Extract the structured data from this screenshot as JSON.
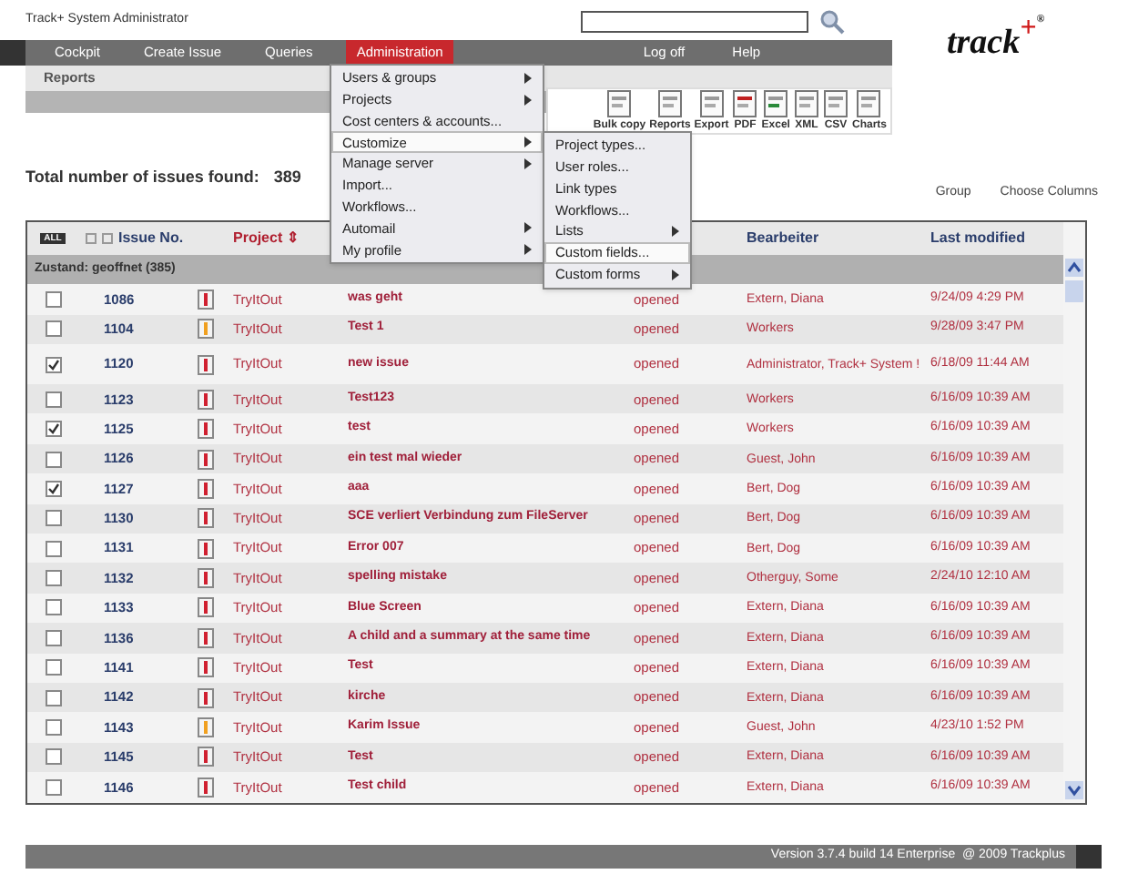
{
  "header": {
    "title": "Track+ System Administrator",
    "logo": {
      "text": "track",
      "plus": "+",
      "mark": "®"
    }
  },
  "nav": [
    {
      "label": "Cockpit",
      "selected": false
    },
    {
      "label": "Create Issue",
      "selected": false
    },
    {
      "label": "Queries",
      "selected": false
    },
    {
      "label": "Administration",
      "selected": true
    }
  ],
  "nav_right": [
    "Log off",
    "Help"
  ],
  "subnav": "Reports",
  "toolbar": [
    "Bulk copy",
    "Reports",
    "Export",
    "PDF",
    "Excel",
    "XML",
    "CSV",
    "Charts"
  ],
  "summary": {
    "label": "Total number of issues found:",
    "count": "389"
  },
  "links": [
    "Group",
    "Choose Columns"
  ],
  "admin_menu": [
    {
      "label": "Users & groups",
      "submenu": true,
      "selected": false
    },
    {
      "label": "Projects",
      "submenu": true,
      "selected": false
    },
    {
      "label": "Cost centers & accounts...",
      "submenu": false,
      "selected": false
    },
    {
      "label": "Customize",
      "submenu": true,
      "selected": true
    },
    {
      "label": "Manage server",
      "submenu": true,
      "selected": false
    },
    {
      "label": "Import...",
      "submenu": false,
      "selected": false
    },
    {
      "label": "Workflows...",
      "submenu": false,
      "selected": false
    },
    {
      "label": "Automail",
      "submenu": true,
      "selected": false
    },
    {
      "label": "My profile",
      "submenu": true,
      "selected": false
    }
  ],
  "customize_menu": [
    {
      "label": "Project types...",
      "submenu": false,
      "selected": false
    },
    {
      "label": "User roles...",
      "submenu": false,
      "selected": false
    },
    {
      "label": "Link types",
      "submenu": false,
      "selected": false
    },
    {
      "label": "Workflows...",
      "submenu": false,
      "selected": false
    },
    {
      "label": "Lists",
      "submenu": true,
      "selected": false
    },
    {
      "label": "Custom fields...",
      "submenu": false,
      "selected": true
    },
    {
      "label": "Custom forms",
      "submenu": true,
      "selected": false
    }
  ],
  "table": {
    "select_all": "ALL",
    "columns": [
      "Issue No.",
      "Project",
      "Bearbeiter",
      "Last modified"
    ],
    "sort_mark": "⇕",
    "group": "Zustand: geoffnet (385)",
    "rows": [
      {
        "checked": false,
        "id": "1086",
        "flagged": false,
        "project": "TryItOut",
        "title": "was geht",
        "status": "opened",
        "assignee": "Extern, Diana",
        "modified": "9/24/09 4:29 PM"
      },
      {
        "checked": false,
        "id": "1104",
        "flagged": true,
        "project": "TryItOut",
        "title": "Test 1",
        "status": "opened",
        "assignee": "Workers",
        "modified": "9/28/09 3:47 PM"
      },
      {
        "checked": true,
        "id": "1120",
        "flagged": false,
        "project": "TryItOut",
        "title": "new issue",
        "status": "opened",
        "assignee": "Administrator, Track+ System !",
        "modified": "6/18/09 11:44 AM"
      },
      {
        "checked": false,
        "id": "1123",
        "flagged": false,
        "project": "TryItOut",
        "title": "Test123",
        "status": "opened",
        "assignee": "Workers",
        "modified": "6/16/09 10:39 AM"
      },
      {
        "checked": true,
        "id": "1125",
        "flagged": false,
        "project": "TryItOut",
        "title": "test",
        "status": "opened",
        "assignee": "Workers",
        "modified": "6/16/09 10:39 AM"
      },
      {
        "checked": false,
        "id": "1126",
        "flagged": false,
        "project": "TryItOut",
        "title": "ein test mal wieder",
        "status": "opened",
        "assignee": "Guest, John",
        "modified": "6/16/09 10:39 AM"
      },
      {
        "checked": true,
        "id": "1127",
        "flagged": false,
        "project": "TryItOut",
        "title": "aaa",
        "status": "opened",
        "assignee": "Bert, Dog",
        "modified": "6/16/09 10:39 AM"
      },
      {
        "checked": false,
        "id": "1130",
        "flagged": false,
        "project": "TryItOut",
        "title": "SCE verliert Verbindung zum FileServer",
        "status": "opened",
        "assignee": "Bert, Dog",
        "modified": "6/16/09 10:39 AM"
      },
      {
        "checked": false,
        "id": "1131",
        "flagged": false,
        "project": "TryItOut",
        "title": "Error 007",
        "status": "opened",
        "assignee": "Bert, Dog",
        "modified": "6/16/09 10:39 AM"
      },
      {
        "checked": false,
        "id": "1132",
        "flagged": false,
        "project": "TryItOut",
        "title": "spelling mistake",
        "status": "opened",
        "assignee": "Otherguy, Some",
        "modified": "2/24/10 12:10 AM"
      },
      {
        "checked": false,
        "id": "1133",
        "flagged": false,
        "project": "TryItOut",
        "title": "Blue Screen",
        "status": "opened",
        "assignee": "Extern, Diana",
        "modified": "6/16/09 10:39 AM"
      },
      {
        "checked": false,
        "id": "1136",
        "flagged": false,
        "project": "TryItOut",
        "title": "A child and a summary at the same time",
        "status": "opened",
        "assignee": "Extern, Diana",
        "modified": "6/16/09 10:39 AM"
      },
      {
        "checked": false,
        "id": "1141",
        "flagged": false,
        "project": "TryItOut",
        "title": "Test",
        "status": "opened",
        "assignee": "Extern, Diana",
        "modified": "6/16/09 10:39 AM"
      },
      {
        "checked": false,
        "id": "1142",
        "flagged": false,
        "project": "TryItOut",
        "title": "kirche",
        "status": "opened",
        "assignee": "Extern, Diana",
        "modified": "6/16/09 10:39 AM"
      },
      {
        "checked": false,
        "id": "1143",
        "flagged": true,
        "project": "TryItOut",
        "title": "Karim Issue",
        "status": "opened",
        "assignee": "Guest, John",
        "modified": "4/23/10 1:52 PM"
      },
      {
        "checked": false,
        "id": "1145",
        "flagged": false,
        "project": "TryItOut",
        "title": "Test",
        "status": "opened",
        "assignee": "Extern, Diana",
        "modified": "6/16/09 10:39 AM"
      },
      {
        "checked": false,
        "id": "1146",
        "flagged": false,
        "project": "TryItOut",
        "title": "Test child",
        "status": "opened",
        "assignee": "Extern, Diana",
        "modified": "6/16/09 10:39 AM"
      }
    ]
  },
  "footer": "Version 3.7.4 build 14 Enterprise  @ 2009 Trackplus"
}
